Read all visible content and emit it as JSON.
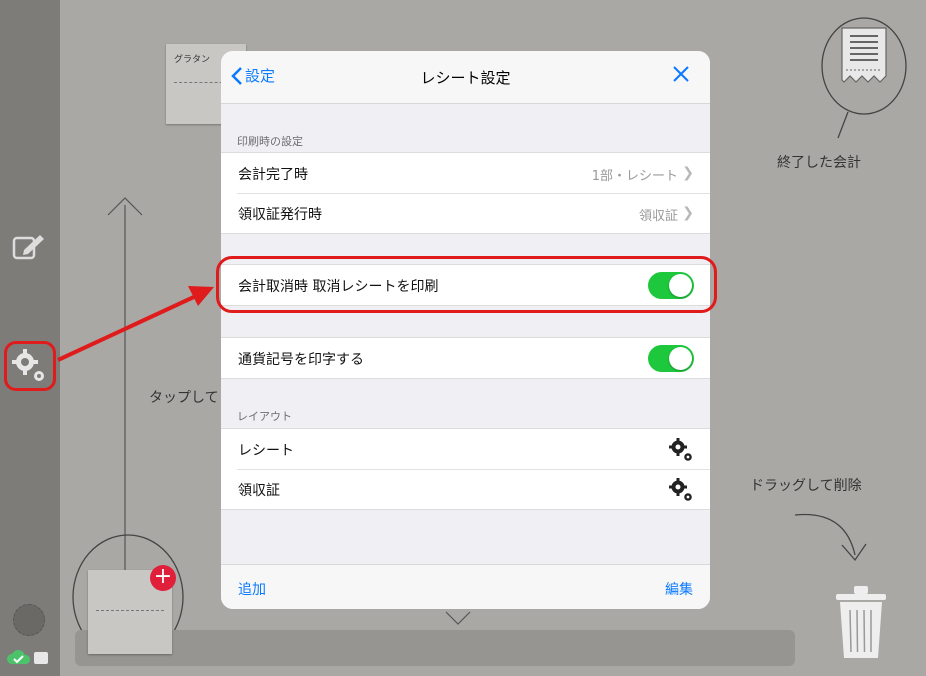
{
  "background": {
    "note_title": "グラタン",
    "finished_label": "終了した会計",
    "tap_hint": "タップして",
    "drag_delete_hint": "ドラッグして削除",
    "plus_symbol": "+"
  },
  "sidebar": {
    "icons": [
      "edit-icon",
      "gear-icon",
      "cloud-sync-icon"
    ]
  },
  "modal": {
    "back_label": "設定",
    "title": "レシート設定",
    "section_print": "印刷時の設定",
    "rows_print": [
      {
        "label": "会計完了時",
        "value": "1部・レシート"
      },
      {
        "label": "領収証発行時",
        "value": "領収証"
      }
    ],
    "cancel_row": {
      "label": "会計取消時 取消レシートを印刷",
      "enabled": true
    },
    "currency_row": {
      "label": "通貨記号を印字する",
      "enabled": true
    },
    "section_layout": "レイアウト",
    "rows_layout": [
      {
        "label": "レシート"
      },
      {
        "label": "領収証"
      }
    ],
    "footer": {
      "add_label": "追加",
      "edit_label": "編集"
    }
  },
  "colors": {
    "accent": "#0a7aff",
    "toggle_on": "#1ec83d",
    "highlight": "#e01b1b"
  }
}
